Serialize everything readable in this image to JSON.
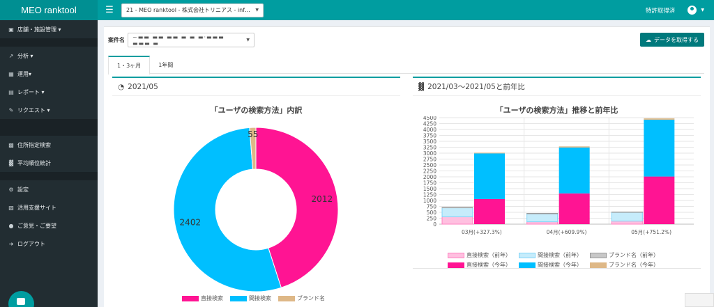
{
  "app": {
    "title": "MEO ranktool"
  },
  "header": {
    "project_select": "21 - MEO ranktool - 株式会社トリニアス - inf…",
    "patent": "特許取得済"
  },
  "sidebar": {
    "items": [
      {
        "label": "店舗・施設管理 ▾",
        "icon": "store-icon"
      },
      {
        "label": "分析 ▾",
        "icon": "chart-line-icon"
      },
      {
        "label": "運用▾",
        "icon": "grid-icon"
      },
      {
        "label": "レポート ▾",
        "icon": "report-icon"
      },
      {
        "label": "リクエスト ▾",
        "icon": "edit-icon"
      },
      {
        "label": "住所指定検索",
        "icon": "map-icon"
      },
      {
        "label": "平均順位統計",
        "icon": "bar-chart-icon"
      },
      {
        "label": "設定",
        "icon": "gear-icon"
      },
      {
        "label": "活用支援サイト",
        "icon": "film-icon"
      },
      {
        "label": "ご意見・ご要望",
        "icon": "comment-icon"
      },
      {
        "label": "ログアウト",
        "icon": "logout-icon"
      }
    ]
  },
  "main": {
    "case_label": "案件名",
    "case_value": "~▬▬  ▬▬  ▬▬ ▬ ▬ ▬·▬▬▬ ▬▬▬ ▬",
    "fetch_button": "データを取得する",
    "tabs": [
      {
        "label": "1・3ヶ月"
      },
      {
        "label": "1年間"
      }
    ],
    "left_panel": {
      "heading": "2021/05"
    },
    "right_panel": {
      "heading": "2021/03〜2021/05と前年比"
    }
  },
  "colors": {
    "accent": "#009da0",
    "direct": "#ff1493",
    "indirect": "#00bfff",
    "brand": "#deb887",
    "direct_prev": "#ffc0e0",
    "indirect_prev": "#c6ecfb",
    "brand_prev": "#c8c8c8"
  },
  "chart_data": [
    {
      "type": "pie",
      "title": "「ユーザの検索方法」内訳",
      "labels": [
        "直接検索",
        "間接検索",
        "ブランド名"
      ],
      "values": [
        2012,
        2402,
        55
      ],
      "legend": "bottom"
    },
    {
      "type": "bar",
      "title": "「ユーザの検索方法」推移と前年比",
      "categories": [
        "03月(+327.3%)",
        "04月(+609.9%)",
        "05月(+751.2%)"
      ],
      "ylim": [
        0,
        4500
      ],
      "yticks": [
        0,
        250,
        500,
        750,
        1000,
        1250,
        1500,
        1750,
        2000,
        2250,
        2500,
        2750,
        3000,
        3250,
        3500,
        3750,
        4000,
        4250,
        4500
      ],
      "stacked": true,
      "series": [
        {
          "name": "直接検索（前年）",
          "stack": "prev",
          "values": [
            310,
            100,
            130
          ]
        },
        {
          "name": "間接検索（前年）",
          "stack": "prev",
          "values": [
            390,
            350,
            380
          ]
        },
        {
          "name": "ブランド名（前年）",
          "stack": "prev",
          "values": [
            5,
            5,
            5
          ]
        },
        {
          "name": "直接検索（今年）",
          "stack": "cur",
          "values": [
            1060,
            1300,
            2012
          ]
        },
        {
          "name": "間接検索（今年）",
          "stack": "cur",
          "values": [
            1930,
            1940,
            2402
          ]
        },
        {
          "name": "ブランド名（今年）",
          "stack": "cur",
          "values": [
            30,
            45,
            55
          ]
        }
      ],
      "legend": "bottom"
    }
  ]
}
